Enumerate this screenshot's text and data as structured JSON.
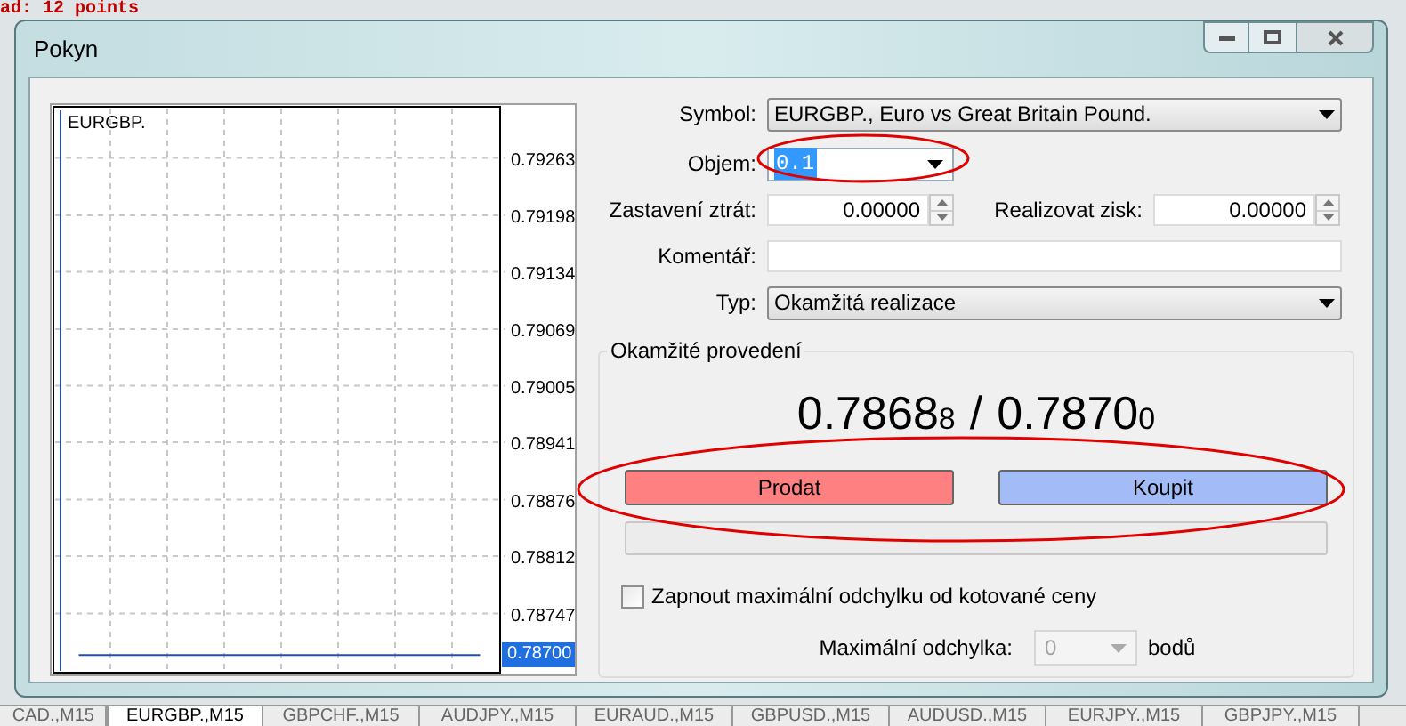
{
  "background": {
    "chart_text": "ad: 12 points",
    "symbol_tabs": [
      {
        "label": "CAD.,M15",
        "selected": false
      },
      {
        "label": "EURGBP.,M15",
        "selected": true
      },
      {
        "label": "GBPCHF.,M15",
        "selected": false
      },
      {
        "label": "AUDJPY.,M15",
        "selected": false
      },
      {
        "label": "EURAUD.,M15",
        "selected": false
      },
      {
        "label": "GBPUSD.,M15",
        "selected": false
      },
      {
        "label": "AUDUSD.,M15",
        "selected": false
      },
      {
        "label": "EURJPY.,M15",
        "selected": false
      },
      {
        "label": "GBPJPY.,M15",
        "selected": false
      }
    ]
  },
  "window": {
    "title": "Pokyn"
  },
  "chart": {
    "symbol": "EURGBP.",
    "price_label": "0.78700",
    "chart_data": {
      "type": "line",
      "grid": true,
      "ylim": [
        0.78678,
        0.79319
      ],
      "yticks": [
        0.79263,
        0.79198,
        0.79134,
        0.79069,
        0.79005,
        0.78941,
        0.78876,
        0.78812,
        0.78747
      ],
      "categories": [
        null,
        null,
        null,
        null,
        null,
        null,
        null,
        null,
        null,
        null,
        null,
        null
      ],
      "series": [
        {
          "color": "#1f4fbf",
          "values": [
            0.787,
            0.787,
            0.787,
            0.787,
            0.787,
            0.787,
            0.787,
            0.787,
            0.787,
            0.787,
            0.787,
            0.787
          ]
        }
      ]
    }
  },
  "form": {
    "symbol": {
      "label": "Symbol:",
      "value": "EURGBP., Euro vs Great Britain Pound."
    },
    "volume": {
      "label": "Objem:",
      "value": "0.1"
    },
    "stop_loss": {
      "label": "Zastavení ztrát:",
      "value": "0.00000"
    },
    "take_profit": {
      "label": "Realizovat zisk:",
      "value": "0.00000"
    },
    "comment": {
      "label": "Komentář:"
    },
    "type": {
      "label": "Typ:",
      "value": "Okamžitá realizace"
    }
  },
  "execution": {
    "title": "Okamžité provedení",
    "bid": "0.7868",
    "bid_pip": "8",
    "separator": "/",
    "ask": "0.7870",
    "ask_pip": "0",
    "sell_button": "Prodat",
    "buy_button": "Koupit",
    "max_deviation_toggle": {
      "label": "Zapnout maximální odchylku od kotované ceny",
      "checked": false
    },
    "max_deviation": {
      "label": "Maximální odchylka:",
      "value": "0",
      "unit": "bodů",
      "disabled": true
    }
  }
}
